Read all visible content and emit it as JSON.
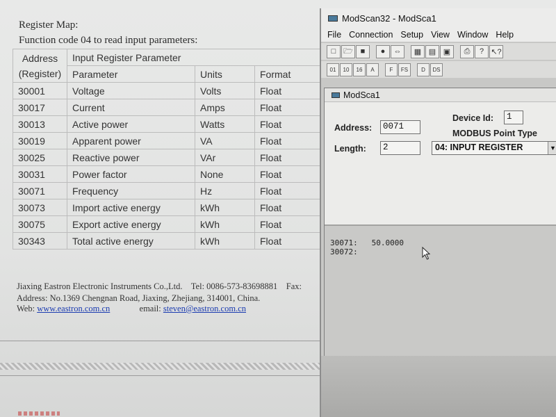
{
  "document": {
    "title": "Register Map:",
    "subtitle": "Function code 04 to read input parameters:",
    "table": {
      "header_address_line1": "Address",
      "header_address_line2": "(Register)",
      "header_group": "Input Register Parameter",
      "columns": [
        "Parameter",
        "Units",
        "Format"
      ],
      "rows": [
        {
          "address": "30001",
          "parameter": "Voltage",
          "units": "Volts",
          "format": "Float"
        },
        {
          "address": "30017",
          "parameter": "Current",
          "units": "Amps",
          "format": "Float"
        },
        {
          "address": "30013",
          "parameter": "Active power",
          "units": "Watts",
          "format": "Float"
        },
        {
          "address": "30019",
          "parameter": "Apparent power",
          "units": "VA",
          "format": "Float"
        },
        {
          "address": "30025",
          "parameter": "Reactive power",
          "units": "VAr",
          "format": "Float"
        },
        {
          "address": "30031",
          "parameter": "Power factor",
          "units": "None",
          "format": "Float"
        },
        {
          "address": "30071",
          "parameter": "Frequency",
          "units": "Hz",
          "format": "Float"
        },
        {
          "address": "30073",
          "parameter": "Import active energy",
          "units": "kWh",
          "format": "Float"
        },
        {
          "address": "30075",
          "parameter": "Export active energy",
          "units": "kWh",
          "format": "Float"
        },
        {
          "address": "30343",
          "parameter": "Total active energy",
          "units": "kWh",
          "format": "Float"
        }
      ]
    },
    "footer": {
      "company": "Jiaxing Eastron Electronic Instruments Co.,Ltd.",
      "tel": "Tel: 0086-573-83698881",
      "fax": "Fax:",
      "address": "Address: No.1369 Chengnan Road, Jiaxing, Zhejiang, 314001, China.",
      "web_label": "Web:",
      "web_link": "www.eastron.com.cn",
      "email_label": "email:",
      "email_link": "steven@eastron.com.cn"
    }
  },
  "app": {
    "title": "ModScan32 - ModSca1",
    "menu": [
      "File",
      "Connection",
      "Setup",
      "View",
      "Window",
      "Help"
    ],
    "child": {
      "title": "ModSca1",
      "address_label": "Address:",
      "address_value": "0071",
      "length_label": "Length:",
      "length_value": "2",
      "device_id_label": "Device Id:",
      "device_id_value": "1",
      "point_type_label": "MODBUS Point Type",
      "point_type_value": "04: INPUT REGISTER",
      "data_lines": [
        "30071:   50.0000",
        "30072:"
      ]
    }
  }
}
